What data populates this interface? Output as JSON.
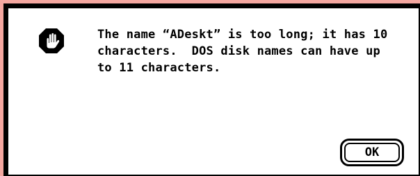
{
  "alert": {
    "message": "The name “ADeskt” is too long; it has 10\ncharacters.  DOS disk names can have up\nto 11 characters.",
    "icon": "stop-hand-icon",
    "ok_label": "OK"
  },
  "colors": {
    "desktop": "#f4a7a0",
    "dialog_background": "#ffffff",
    "border": "#000000"
  }
}
